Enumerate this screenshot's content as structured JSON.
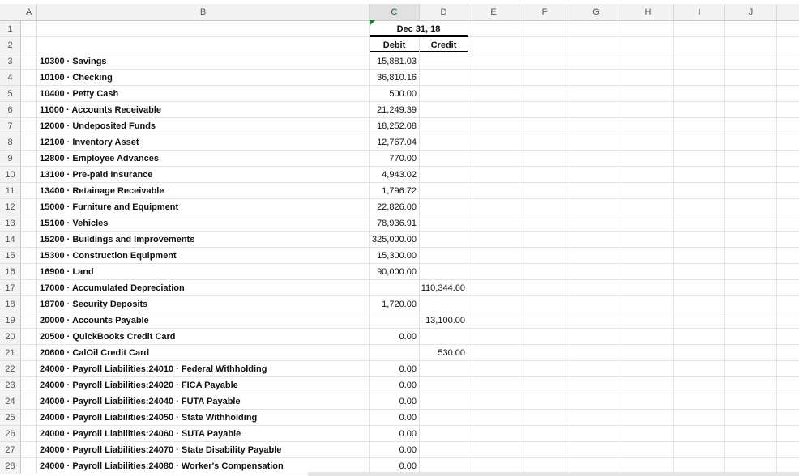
{
  "columns": [
    "A",
    "B",
    "C",
    "D",
    "E",
    "F",
    "G",
    "H",
    "I",
    "J"
  ],
  "header": {
    "period": "Dec 31, 18",
    "debit": "Debit",
    "credit": "Credit"
  },
  "rows": [
    {
      "num": "1"
    },
    {
      "num": "2"
    },
    {
      "num": "3",
      "account": "10300 · Savings",
      "debit": "15,881.03",
      "credit": ""
    },
    {
      "num": "4",
      "account": "10100 · Checking",
      "debit": "36,810.16",
      "credit": ""
    },
    {
      "num": "5",
      "account": "10400 · Petty Cash",
      "debit": "500.00",
      "credit": ""
    },
    {
      "num": "6",
      "account": "11000 · Accounts Receivable",
      "debit": "21,249.39",
      "credit": ""
    },
    {
      "num": "7",
      "account": "12000 · Undeposited Funds",
      "debit": "18,252.08",
      "credit": ""
    },
    {
      "num": "8",
      "account": "12100 · Inventory Asset",
      "debit": "12,767.04",
      "credit": ""
    },
    {
      "num": "9",
      "account": "12800 · Employee Advances",
      "debit": "770.00",
      "credit": ""
    },
    {
      "num": "10",
      "account": "13100 · Pre-paid Insurance",
      "debit": "4,943.02",
      "credit": ""
    },
    {
      "num": "11",
      "account": "13400 · Retainage Receivable",
      "debit": "1,796.72",
      "credit": ""
    },
    {
      "num": "12",
      "account": "15000 · Furniture and Equipment",
      "debit": "22,826.00",
      "credit": ""
    },
    {
      "num": "13",
      "account": "15100 · Vehicles",
      "debit": "78,936.91",
      "credit": ""
    },
    {
      "num": "14",
      "account": "15200 · Buildings and Improvements",
      "debit": "325,000.00",
      "credit": ""
    },
    {
      "num": "15",
      "account": "15300 · Construction Equipment",
      "debit": "15,300.00",
      "credit": ""
    },
    {
      "num": "16",
      "account": "16900 · Land",
      "debit": "90,000.00",
      "credit": ""
    },
    {
      "num": "17",
      "account": "17000 · Accumulated Depreciation",
      "debit": "",
      "credit": "110,344.60"
    },
    {
      "num": "18",
      "account": "18700 · Security Deposits",
      "debit": "1,720.00",
      "credit": ""
    },
    {
      "num": "19",
      "account": "20000 · Accounts Payable",
      "debit": "",
      "credit": "13,100.00"
    },
    {
      "num": "20",
      "account": "20500 · QuickBooks Credit Card",
      "debit": "0.00",
      "credit": ""
    },
    {
      "num": "21",
      "account": "20600 · CalOil Credit Card",
      "debit": "",
      "credit": "530.00"
    },
    {
      "num": "22",
      "account": "24000 · Payroll Liabilities:24010 · Federal Withholding",
      "debit": "0.00",
      "credit": ""
    },
    {
      "num": "23",
      "account": "24000 · Payroll Liabilities:24020 · FICA Payable",
      "debit": "0.00",
      "credit": ""
    },
    {
      "num": "24",
      "account": "24000 · Payroll Liabilities:24040 · FUTA Payable",
      "debit": "0.00",
      "credit": ""
    },
    {
      "num": "25",
      "account": "24000 · Payroll Liabilities:24050 · State Withholding",
      "debit": "0.00",
      "credit": ""
    },
    {
      "num": "26",
      "account": "24000 · Payroll Liabilities:24060 · SUTA Payable",
      "debit": "0.00",
      "credit": ""
    },
    {
      "num": "27",
      "account": "24000 · Payroll Liabilities:24070 · State Disability Payable",
      "debit": "0.00",
      "credit": ""
    },
    {
      "num": "28",
      "account": "24000 · Payroll Liabilities:24080 · Worker's Compensation",
      "debit": "0.00",
      "credit": ""
    }
  ]
}
